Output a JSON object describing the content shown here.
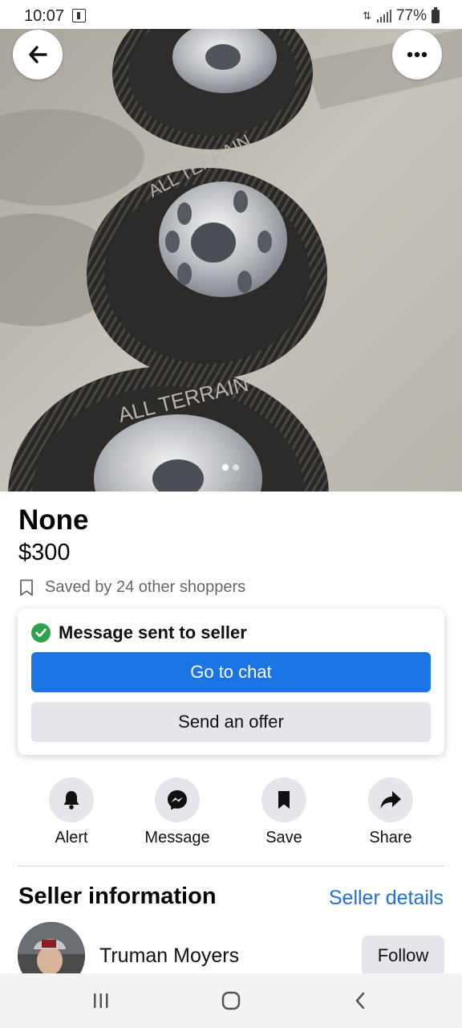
{
  "status_bar": {
    "time": "10:07",
    "battery_percent": "77%",
    "icons": [
      "notification-icon",
      "data-transfer-icon",
      "signal-icon",
      "battery-icon"
    ]
  },
  "hero": {
    "image_description_icon": "tire-photo",
    "image_count": 2,
    "active_image_index": 0,
    "back_icon": "arrow-left-icon",
    "more_icon": "more-horizontal-icon"
  },
  "listing": {
    "title": "None",
    "price": "$300",
    "saved_text": "Saved by 24 other shoppers"
  },
  "message_card": {
    "status_text": "Message sent to seller",
    "primary_button": "Go to chat",
    "secondary_button": "Send an offer"
  },
  "actions": [
    {
      "label": "Alert",
      "icon": "bell-icon"
    },
    {
      "label": "Message",
      "icon": "messenger-icon"
    },
    {
      "label": "Save",
      "icon": "bookmark-icon"
    },
    {
      "label": "Share",
      "icon": "share-icon"
    }
  ],
  "seller": {
    "heading": "Seller information",
    "details_link": "Seller details",
    "name": "Truman Moyers",
    "follow_button": "Follow"
  },
  "colors": {
    "primary": "#1b74e4",
    "link": "#216fdb",
    "success": "#31a24c",
    "secondary_bg": "#e4e6eb"
  },
  "nav_bar": {
    "buttons": [
      "recent-apps-icon",
      "home-icon",
      "back-nav-icon"
    ]
  }
}
